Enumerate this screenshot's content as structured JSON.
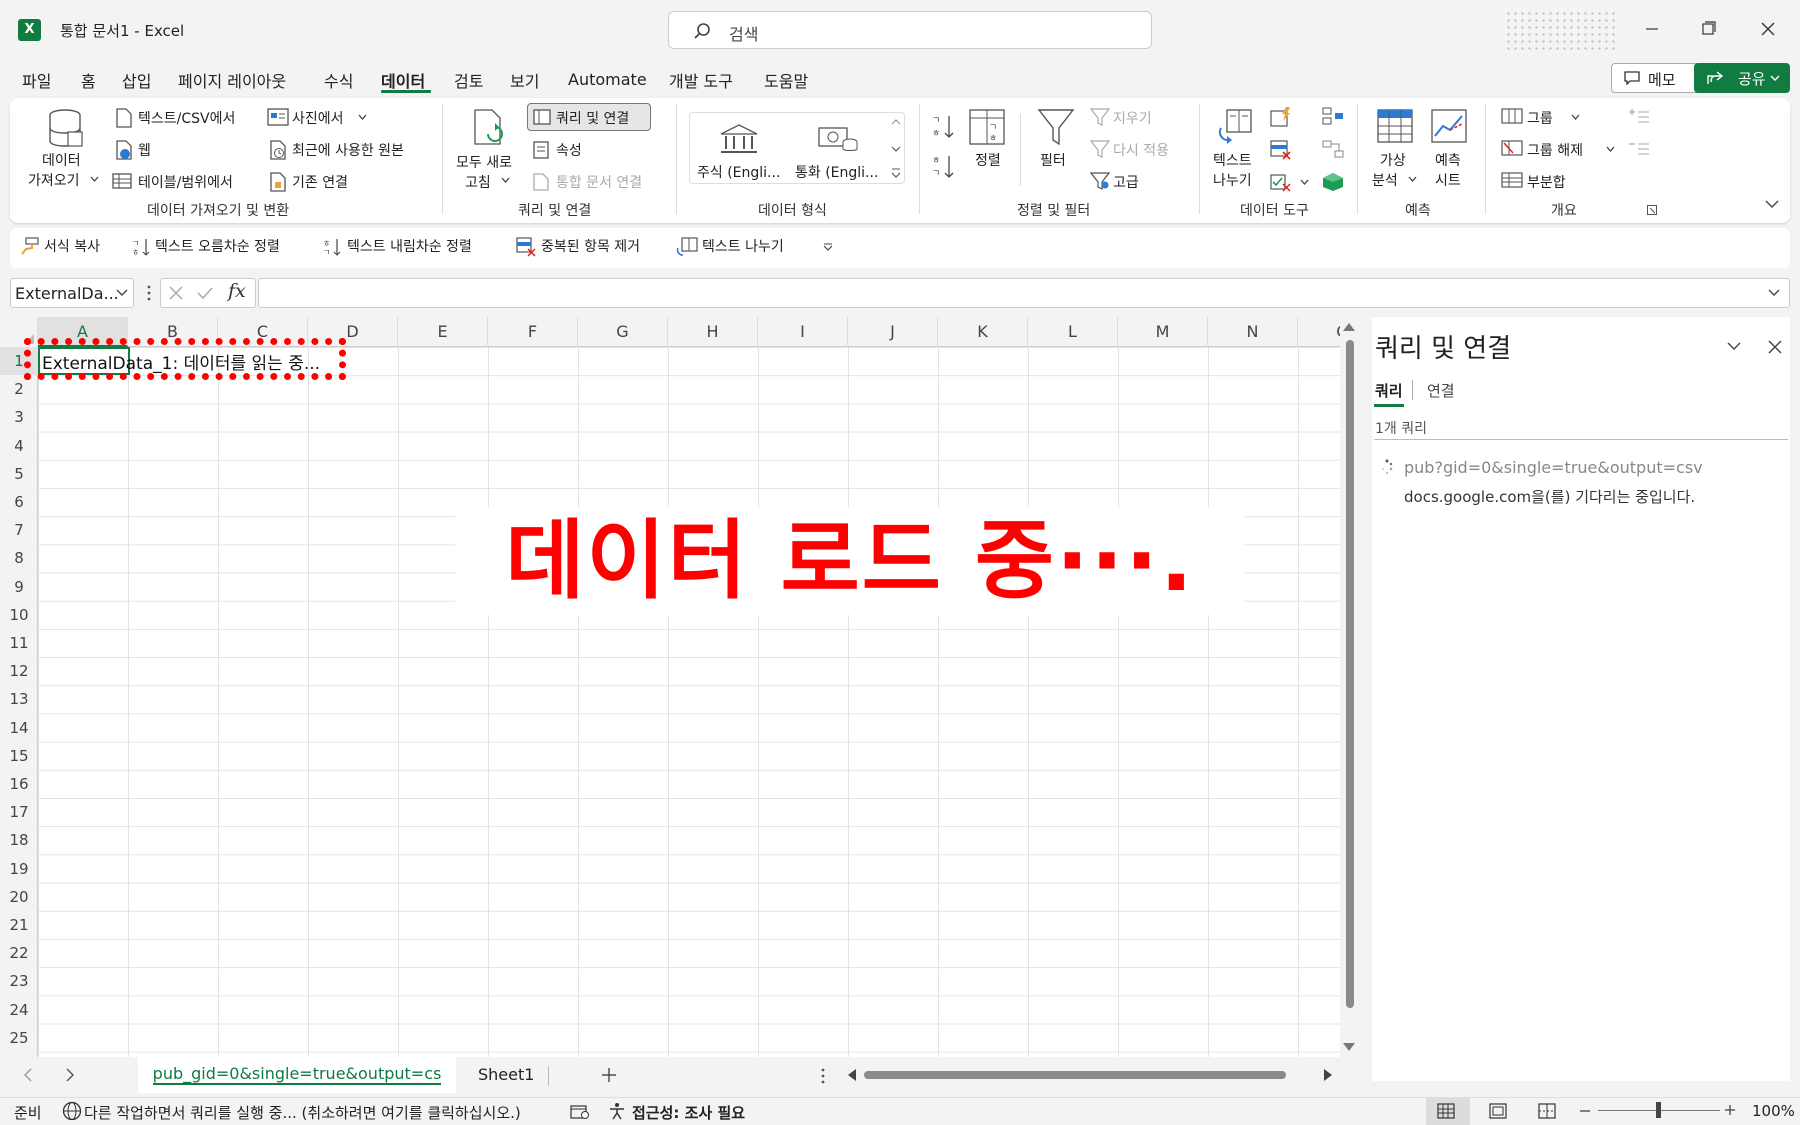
{
  "app": {
    "logo_letter": "X",
    "title": "통합 문서1  -  Excel"
  },
  "search": {
    "placeholder": "검색"
  },
  "menu": {
    "items": [
      "파일",
      "홈",
      "삽입",
      "페이지 레이아웃",
      "수식",
      "데이터",
      "검토",
      "보기",
      "Automate",
      "개발 도구",
      "도움말"
    ],
    "active": "데이터",
    "memo_label": "메모",
    "share_label": "공유"
  },
  "ribbon": {
    "get_data": {
      "big_label_1": "데이터",
      "big_label_2": "가져오기",
      "text_csv": "텍스트/CSV에서",
      "web": "웹",
      "table_range": "테이블/범위에서",
      "from_picture": "사진에서",
      "recent_sources": "최근에 사용한 원본",
      "existing_connections": "기존 연결",
      "group_label": "데이터 가져오기 및 변환"
    },
    "queries": {
      "refresh_all_1": "모두 새로",
      "refresh_all_2": "고침",
      "queries_connections": "쿼리 및 연결",
      "properties": "속성",
      "edit_links": "통합 문서 연결",
      "group_label": "쿼리 및 연결"
    },
    "data_types": {
      "stocks": "주식 (Engli...",
      "currencies": "통화 (Engli...",
      "group_label": "데이터 형식"
    },
    "sort_filter": {
      "sort": "정렬",
      "filter": "필터",
      "clear": "지우기",
      "reapply": "다시 적용",
      "advanced": "고급",
      "group_label": "정렬 및 필터"
    },
    "data_tools": {
      "text_to_columns_1": "텍스트",
      "text_to_columns_2": "나누기",
      "group_label": "데이터 도구"
    },
    "forecast": {
      "what_if_1": "가상",
      "what_if_2": "분석",
      "forecast_sheet_1": "예측",
      "forecast_sheet_2": "시트",
      "group_label": "예측"
    },
    "outline": {
      "group": "그룹",
      "ungroup": "그룹 해제",
      "subtotal": "부분합",
      "group_label": "개요"
    }
  },
  "quick_access": {
    "format_painter": "서식 복사",
    "sort_asc": "텍스트 오름차순 정렬",
    "sort_desc": "텍스트 내림차순 정렬",
    "remove_duplicates": "중복된 항목 제거",
    "text_to_columns": "텍스트 나누기"
  },
  "formula_bar": {
    "name_box": "ExternalDa...",
    "fx": "fx",
    "formula": ""
  },
  "grid": {
    "columns": [
      "A",
      "B",
      "C",
      "D",
      "E",
      "F",
      "G",
      "H",
      "I",
      "J",
      "K",
      "L",
      "M",
      "N",
      "O"
    ],
    "rows": [
      "1",
      "2",
      "3",
      "4",
      "5",
      "6",
      "7",
      "8",
      "9",
      "10",
      "11",
      "12",
      "13",
      "14",
      "15",
      "16",
      "17",
      "18",
      "19",
      "20",
      "21",
      "22",
      "23",
      "24",
      "25"
    ],
    "a1_text": "ExternalData_1: 데이터를 읽는 중...",
    "overlay_text": "데이터 로드 중···."
  },
  "sheets": {
    "tabs": [
      "pub_gid=0&single=true&output=cs",
      "Sheet1"
    ],
    "active": 0
  },
  "pane": {
    "title": "쿼리 및 연결",
    "tab_queries": "쿼리",
    "tab_connections": "연결",
    "count": "1개 쿼리",
    "query_name": "pub?gid=0&single=true&output=csv",
    "query_status": "docs.google.com을(를) 기다리는 중입니다."
  },
  "status": {
    "ready": "준비",
    "message": "다른 작업하면서 쿼리를 실행 중... (취소하려면 여기를 클릭하십시오.)",
    "accessibility": "접근성: 조사 필요",
    "zoom": "100%"
  },
  "colors": {
    "accent": "#107c41",
    "highlight": "#ff0000"
  }
}
